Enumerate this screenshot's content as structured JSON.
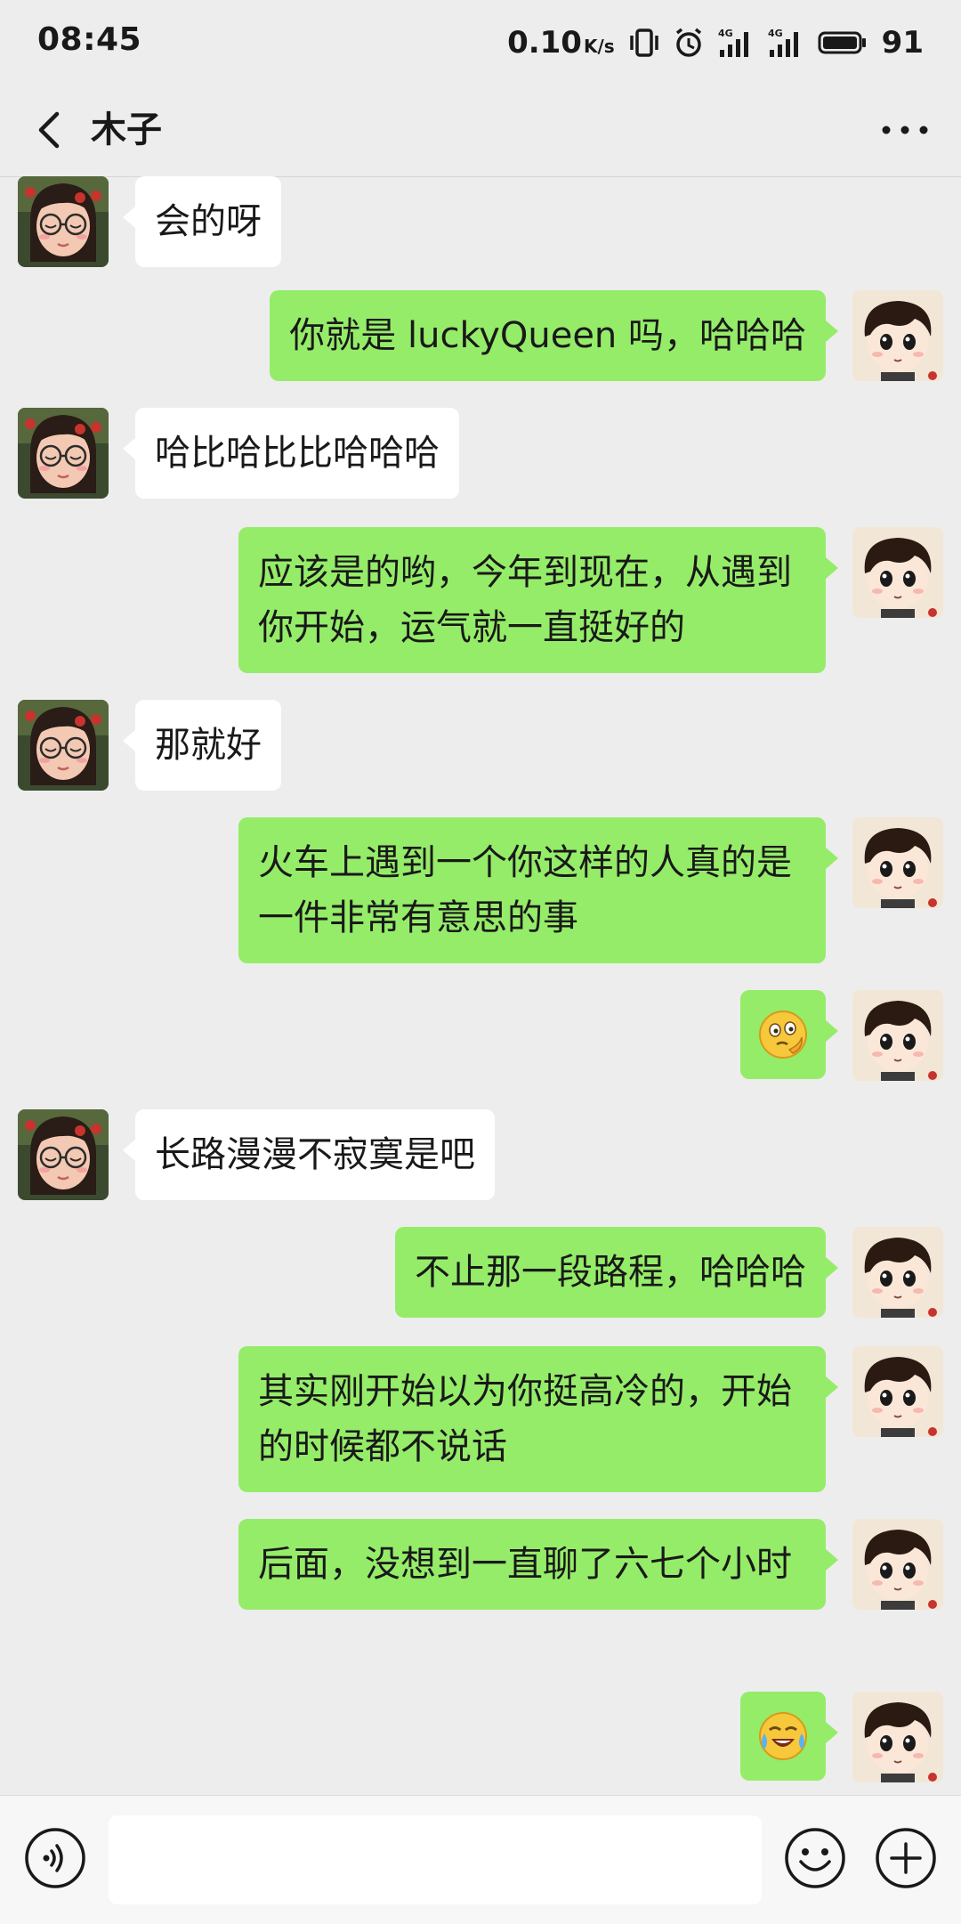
{
  "status_bar": {
    "time": "08:45",
    "net_speed": "0.10",
    "net_speed_unit": "K/s",
    "battery": "91"
  },
  "header": {
    "title": "木子",
    "back_icon": "chevron-left-icon",
    "more_icon": "more-dots-icon"
  },
  "messages": [
    {
      "side": "in",
      "text": "会的呀"
    },
    {
      "side": "out",
      "text": "你就是 luckyQueen 吗，哈哈哈"
    },
    {
      "side": "in",
      "text": "哈比哈比比哈哈哈"
    },
    {
      "side": "out",
      "text": "应该是的哟，今年到现在，从遇到你开始，运气就一直挺好的"
    },
    {
      "side": "in",
      "text": "那就好"
    },
    {
      "side": "out",
      "text": "火车上遇到一个你这样的人真的是一件非常有意思的事"
    },
    {
      "side": "out",
      "emoji": "thinking-face-emoji"
    },
    {
      "side": "in",
      "text": "长路漫漫不寂寞是吧"
    },
    {
      "side": "out",
      "text": "不止那一段路程，哈哈哈"
    },
    {
      "side": "out",
      "text": "其实刚开始以为你挺高冷的，开始的时候都不说话"
    },
    {
      "side": "out",
      "text": "后面，没想到一直聊了六七个小时"
    },
    {
      "side": "out",
      "emoji": "crying-laughing-emoji"
    }
  ],
  "input_bar": {
    "placeholder": "",
    "voice_icon": "voice-icon",
    "emoji_icon": "emoji-icon",
    "plus_icon": "plus-icon"
  },
  "colors": {
    "background": "#ededed",
    "outgoing_bubble": "#95ec69",
    "incoming_bubble": "#ffffff"
  }
}
